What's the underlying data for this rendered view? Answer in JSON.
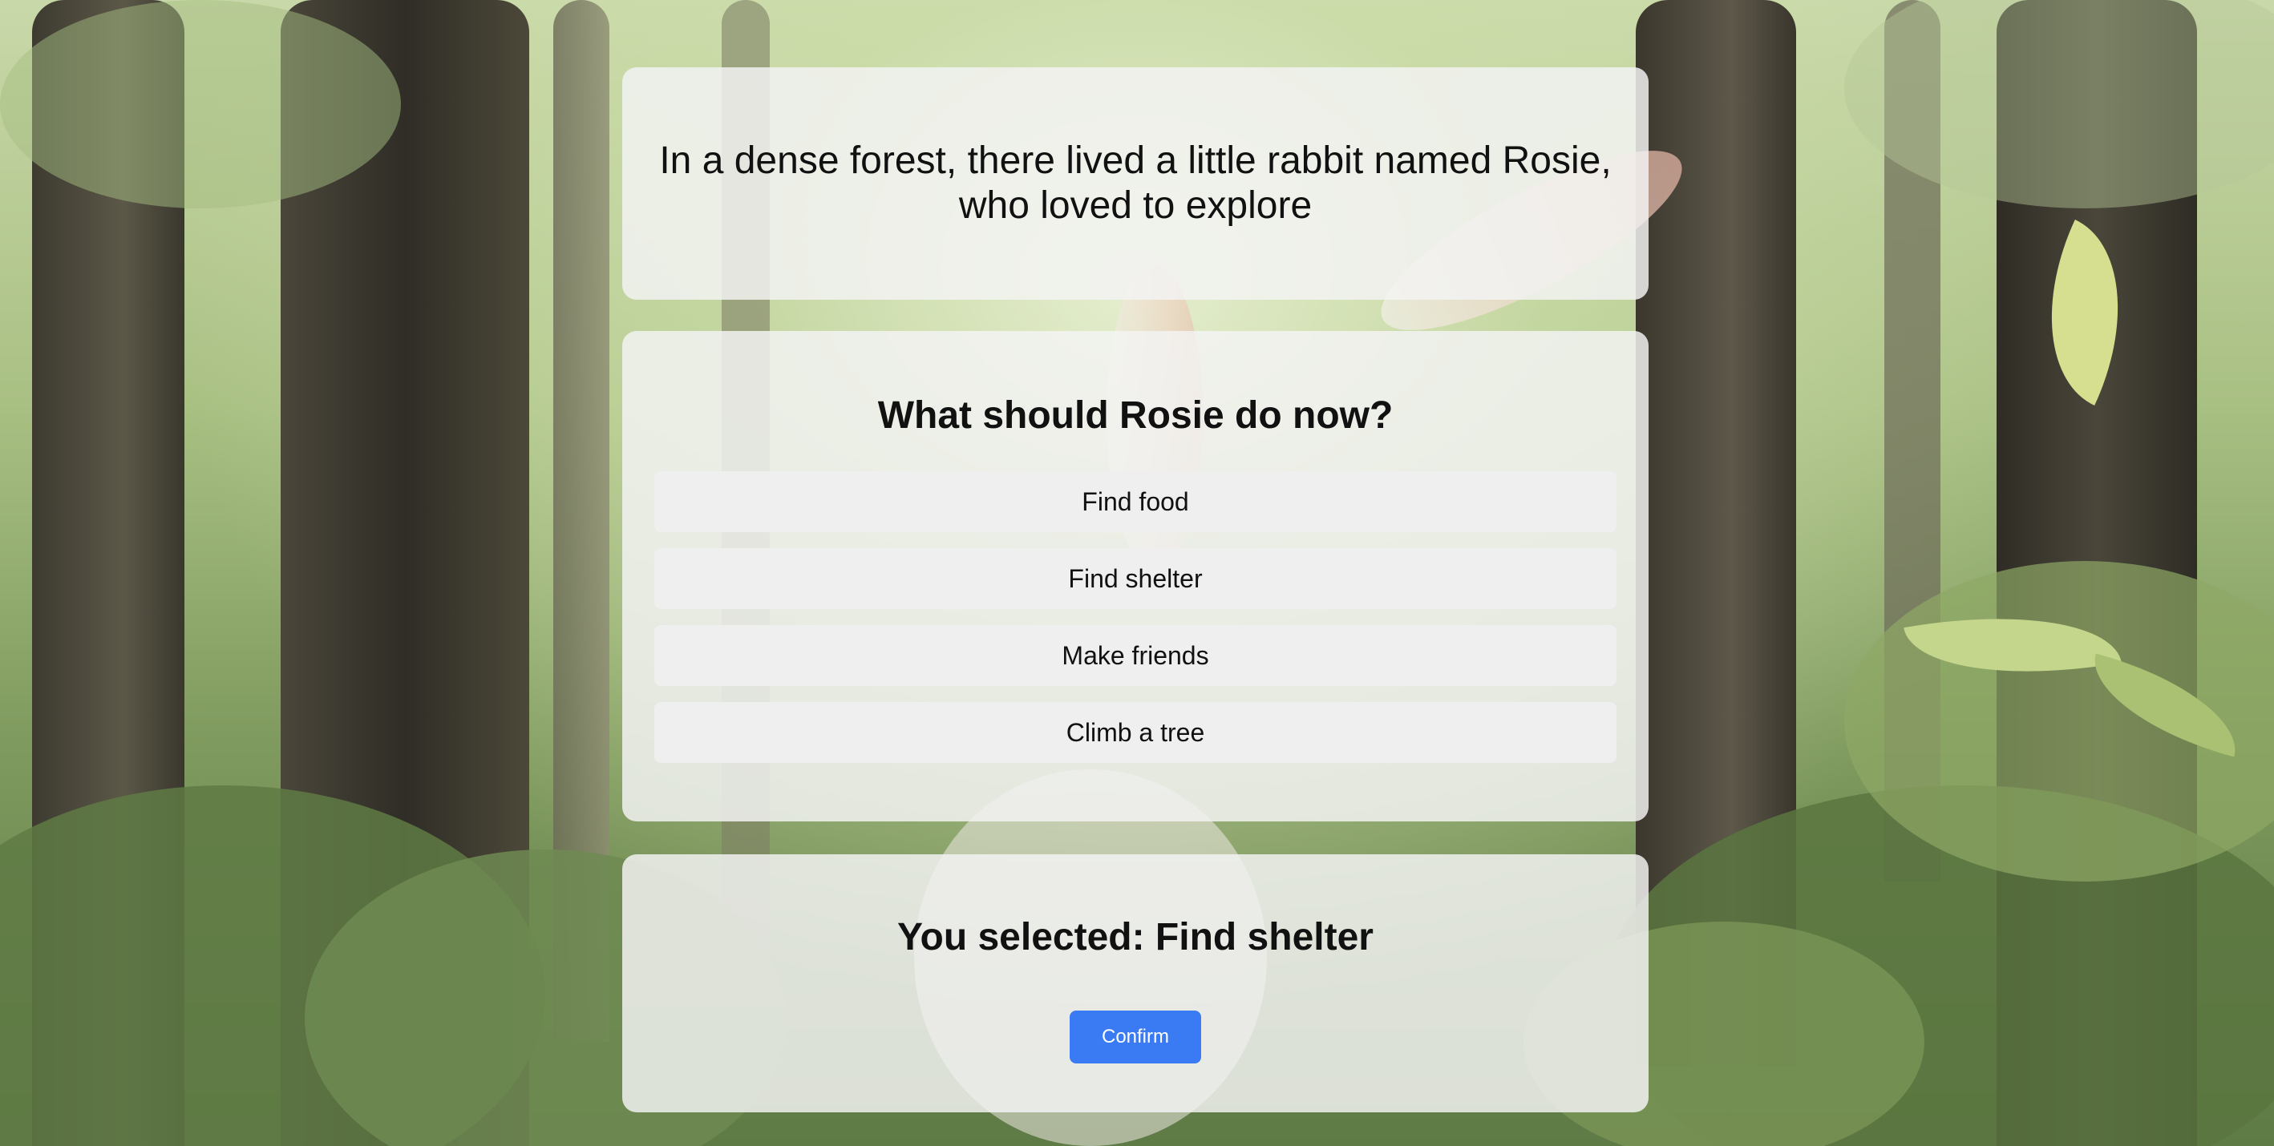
{
  "story": {
    "text": "In a dense forest, there lived a little rabbit named Rosie, who loved to explore"
  },
  "question": {
    "title": "What should Rosie do now?",
    "options": [
      {
        "label": "Find food"
      },
      {
        "label": "Find shelter"
      },
      {
        "label": "Make friends"
      },
      {
        "label": "Climb a tree"
      }
    ]
  },
  "result": {
    "text": "You selected: Find shelter",
    "confirm_label": "Confirm"
  },
  "colors": {
    "accent": "#3a7bf3",
    "panel": "#f3f3f3",
    "option": "#efefef"
  }
}
